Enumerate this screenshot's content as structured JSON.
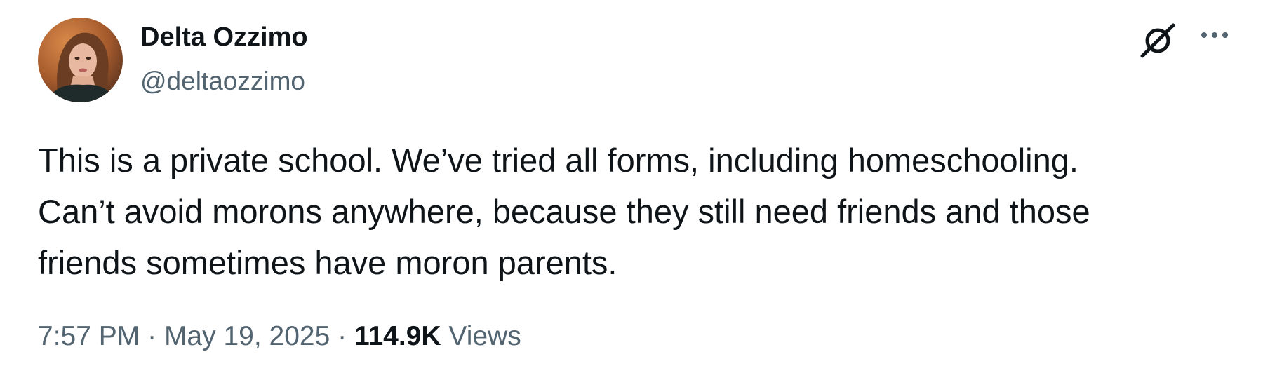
{
  "author": {
    "display_name": "Delta Ozzimo",
    "handle": "@deltaozzimo",
    "avatar_icon": "profile-photo"
  },
  "actions": {
    "grok_icon": "grok-icon",
    "more_icon": "more-horizontal-icon"
  },
  "tweet": {
    "text": "This is a private school. We’ve tried all forms, including homeschooling.\nCan’t avoid morons anywhere, because they still need friends and those\nfriends sometimes have moron parents."
  },
  "meta": {
    "time": "7:57 PM",
    "separator": "·",
    "date": "May 19, 2025",
    "views_count": "114.9K",
    "views_label": "Views"
  },
  "colors": {
    "text_primary": "#0f1419",
    "text_secondary": "#536471",
    "background": "#ffffff"
  }
}
